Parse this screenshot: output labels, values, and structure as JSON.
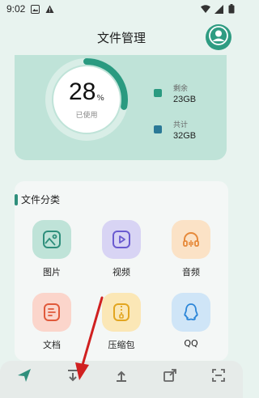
{
  "status_bar": {
    "time": "9:02",
    "icons_left": [
      "image-notification-icon",
      "warning-icon"
    ],
    "icons_right": [
      "wifi-icon",
      "signal-icon",
      "battery-icon"
    ]
  },
  "header": {
    "title": "文件管理",
    "avatar_icon": "user-avatar-icon"
  },
  "storage": {
    "used_percent": "28",
    "percent_unit": "%",
    "used_fraction": 0.28,
    "used_label": "已使用",
    "remaining_label": "剩余",
    "remaining_value": "23GB",
    "total_label": "共计",
    "total_value": "32GB",
    "colors": {
      "ring_used": "#2a9a80",
      "ring_track": "#d9eee7",
      "remaining_swatch": "#2a9a80",
      "total_swatch": "#2a7896"
    }
  },
  "categories": {
    "title": "文件分类",
    "items": [
      {
        "label": "图片",
        "icon": "image-icon",
        "bg": "#bfe3d8",
        "color": "#2f8f7c"
      },
      {
        "label": "视频",
        "icon": "video-icon",
        "bg": "#d8d4f4",
        "color": "#6a5bd0"
      },
      {
        "label": "音频",
        "icon": "headphones-icon",
        "bg": "#fbe2c6",
        "color": "#e6893a"
      },
      {
        "label": "文档",
        "icon": "document-icon",
        "bg": "#fbd5cb",
        "color": "#e0593a"
      },
      {
        "label": "压缩包",
        "icon": "archive-icon",
        "bg": "#fbe7b6",
        "color": "#e2a520"
      },
      {
        "label": "QQ",
        "icon": "qq-icon",
        "bg": "#cfe5f7",
        "color": "#2c86d8"
      }
    ]
  },
  "bottom_nav": {
    "items": [
      "send-icon",
      "download-icon",
      "upload-icon",
      "share-icon",
      "scan-icon"
    ]
  },
  "annotation": {
    "type": "red-arrow",
    "color": "#d02020"
  }
}
